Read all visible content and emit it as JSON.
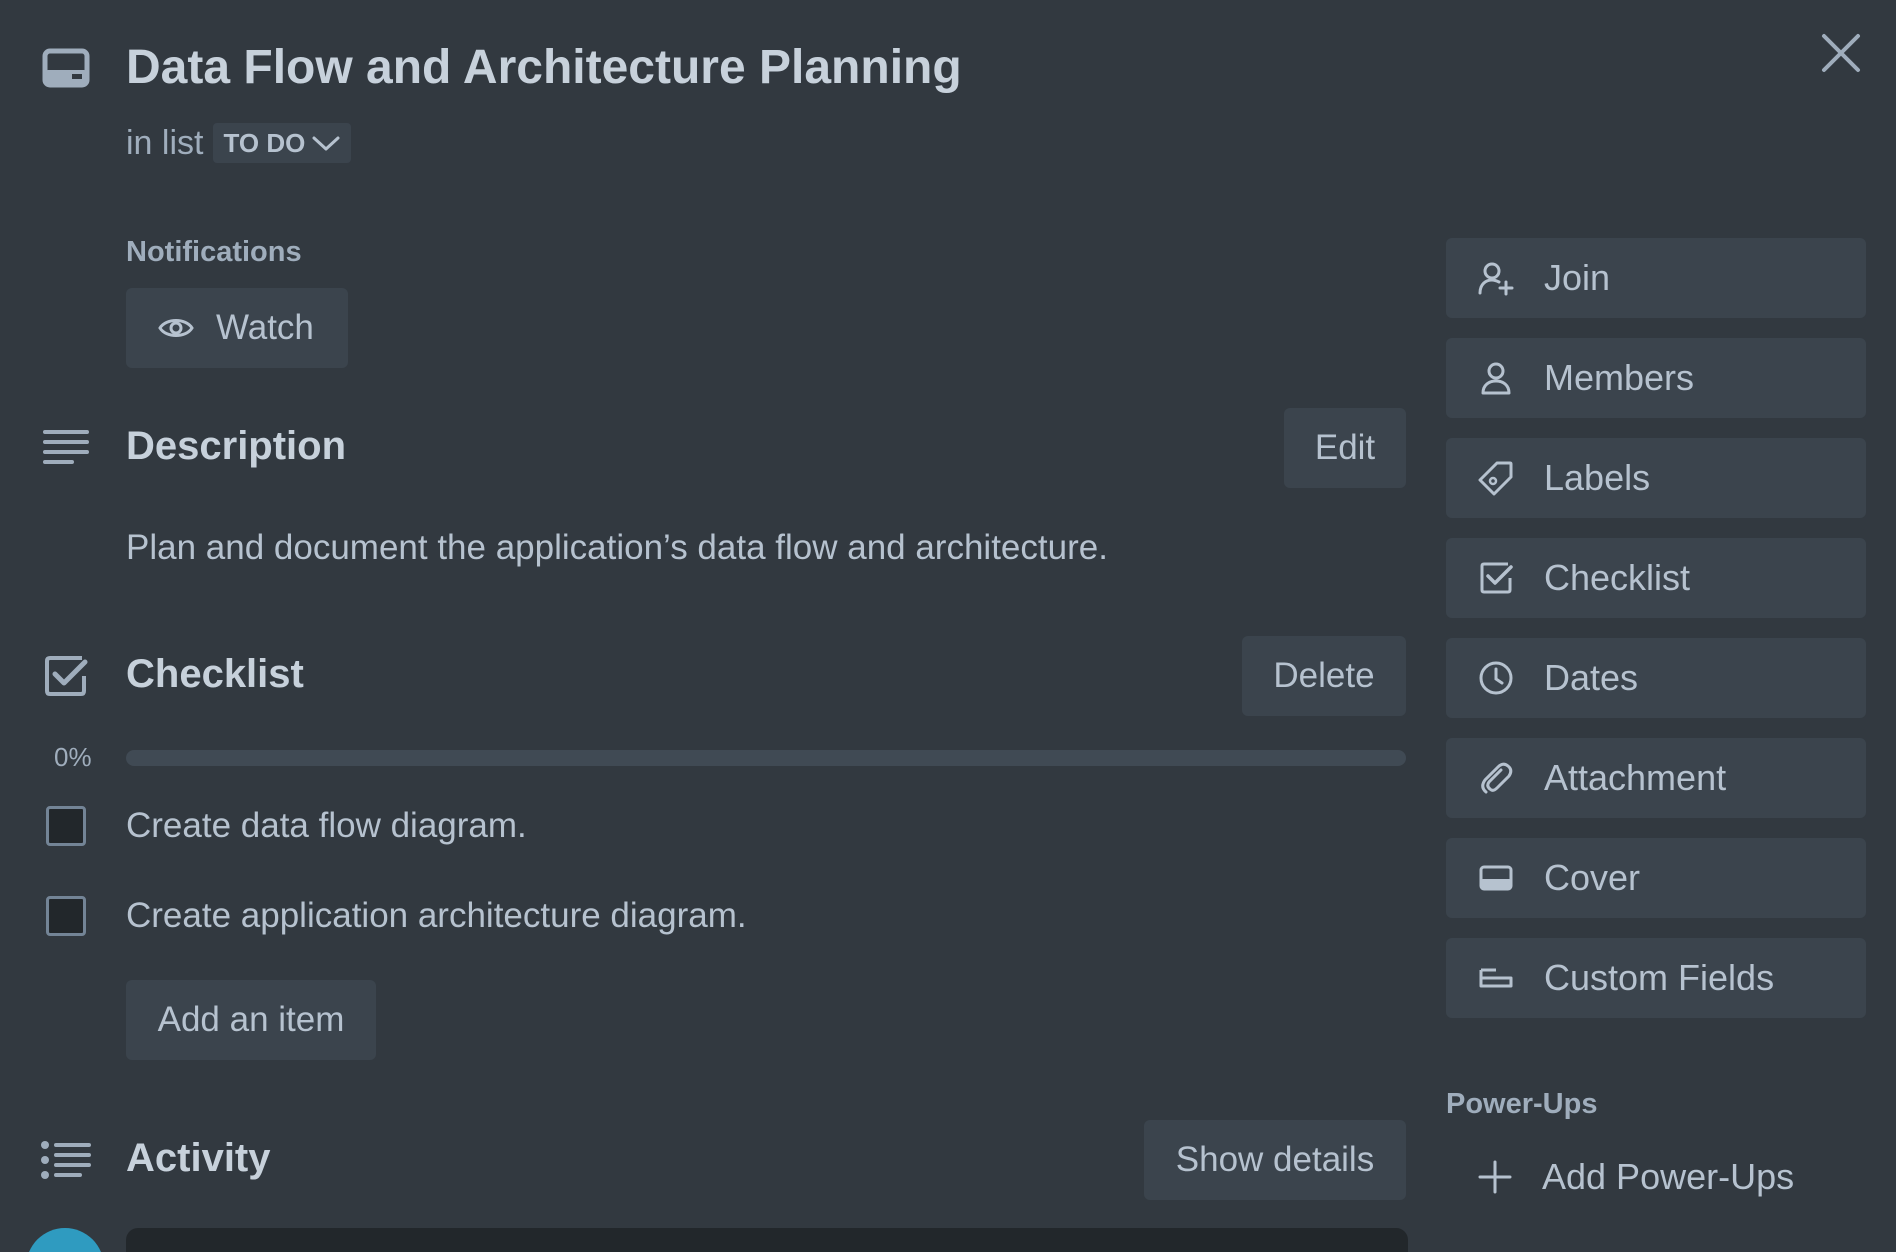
{
  "card": {
    "title": "Data Flow and Architecture Planning",
    "in_list_prefix": "in list",
    "list_name": "TO DO"
  },
  "notifications": {
    "label": "Notifications",
    "watch_label": "Watch"
  },
  "description": {
    "heading": "Description",
    "edit_label": "Edit",
    "text": "Plan and document the application’s data flow and architecture."
  },
  "checklist": {
    "heading": "Checklist",
    "delete_label": "Delete",
    "progress_text": "0%",
    "progress": 0,
    "items": [
      {
        "label": "Create data flow diagram.",
        "checked": false
      },
      {
        "label": "Create application architecture diagram.",
        "checked": false
      }
    ],
    "add_item_label": "Add an item"
  },
  "activity": {
    "heading": "Activity",
    "show_details_label": "Show details"
  },
  "sidebar": {
    "buttons": [
      {
        "label": "Join",
        "icon": "add-member-icon"
      },
      {
        "label": "Members",
        "icon": "person-icon"
      },
      {
        "label": "Labels",
        "icon": "label-icon"
      },
      {
        "label": "Checklist",
        "icon": "checklist-icon"
      },
      {
        "label": "Dates",
        "icon": "clock-icon"
      },
      {
        "label": "Attachment",
        "icon": "paperclip-icon"
      },
      {
        "label": "Cover",
        "icon": "cover-icon"
      },
      {
        "label": "Custom Fields",
        "icon": "custom-fields-icon"
      }
    ],
    "power_ups_label": "Power-Ups",
    "add_power_ups_label": "Add Power-Ups"
  },
  "colors": {
    "background": "#323940",
    "button": "#3b444d",
    "text": "#b6c2cf",
    "avatar": "#2f9bc0"
  }
}
